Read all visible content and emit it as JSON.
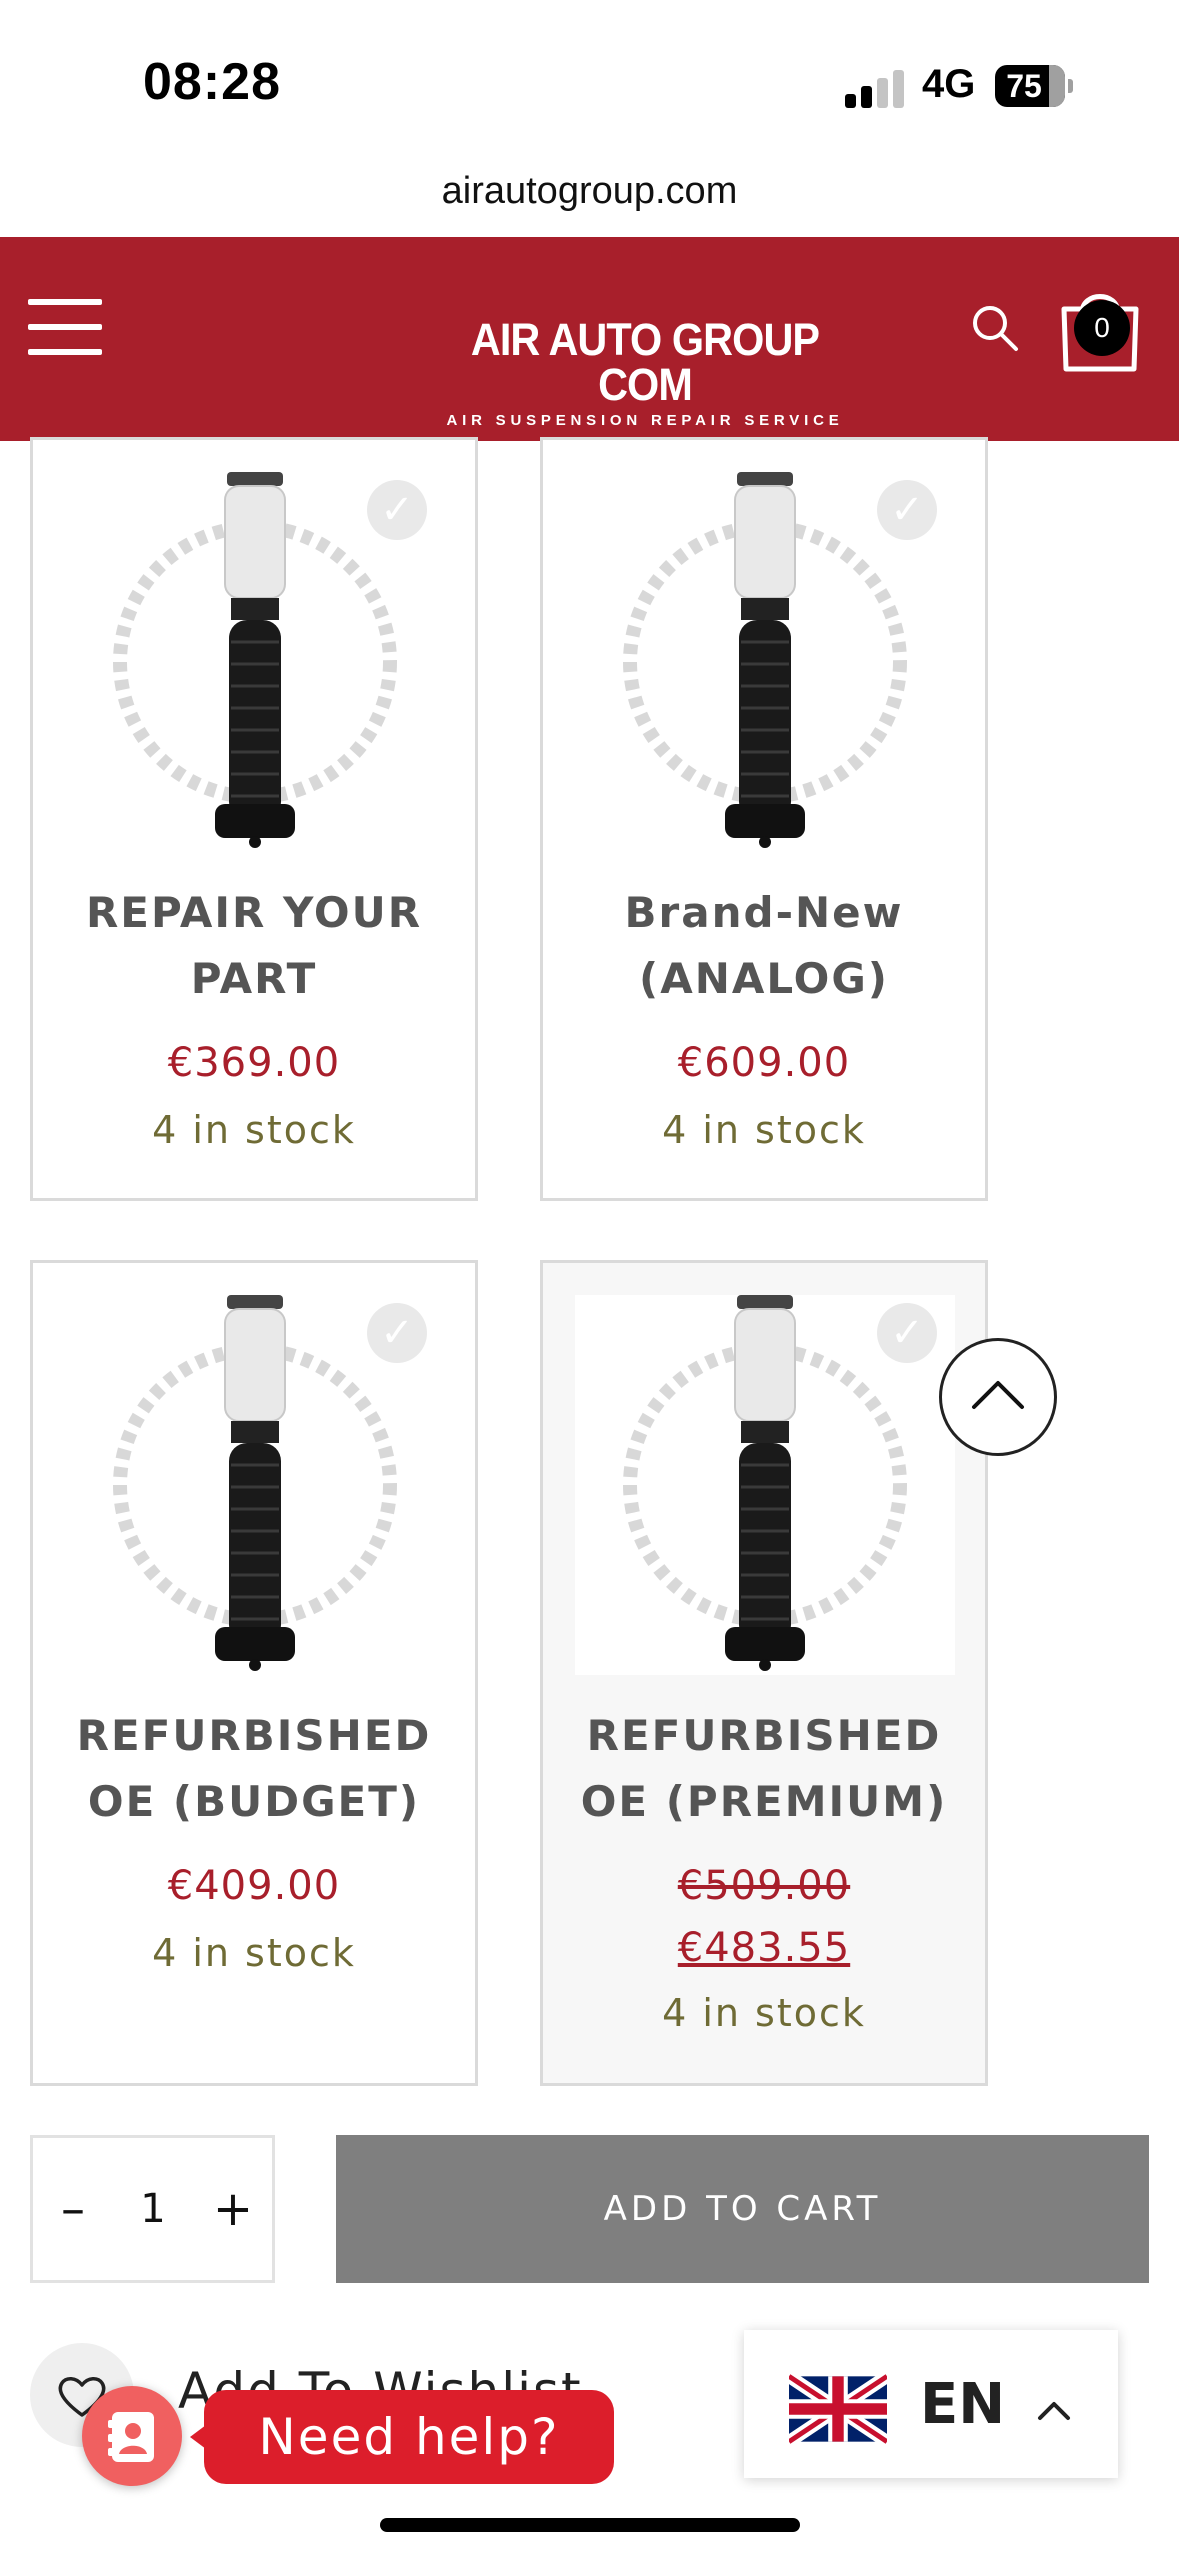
{
  "status_bar": {
    "time": "08:28",
    "network": "4G",
    "battery": "75"
  },
  "browser": {
    "url": "airautogroup.com"
  },
  "header": {
    "logo_title": "AIR AUTO GROUP COM",
    "logo_subtitle": "AIR SUSPENSION REPAIR SERVICE",
    "cart_count": "0",
    "icons": [
      "hamburger-menu-icon",
      "search-icon",
      "shopping-bag-icon"
    ]
  },
  "products": [
    {
      "title_line1": "REPAIR YOUR",
      "title_line2": "PART",
      "price": "€369.00",
      "stock": "4 in stock",
      "selected": false
    },
    {
      "title_line1": "Brand-New",
      "title_line2": "(ANALOG)",
      "price": "€609.00",
      "stock": "4 in stock",
      "selected": false
    },
    {
      "title_line1": "REFURBISHED",
      "title_line2": "OE (BUDGET)",
      "price": "€409.00",
      "stock": "4 in stock",
      "selected": false
    },
    {
      "title_line1": "REFURBISHED",
      "title_line2": "OE (PREMIUM)",
      "old_price": "€509.00",
      "price": "€483.55",
      "stock": "4 in stock",
      "selected": true
    }
  ],
  "purchase": {
    "minus": "–",
    "quantity": "1",
    "plus": "+",
    "add_to_cart": "ADD TO CART"
  },
  "wishlist": {
    "label": "Add To Wishlist"
  },
  "help": {
    "label": "Need help?"
  },
  "language": {
    "code": "EN"
  },
  "colors": {
    "brand_red": "#a81f2b",
    "price_red": "#a81f2b",
    "stock_olive": "#6f6b35",
    "button_gray": "#7f7f7f",
    "help_red": "#dc1e2b"
  }
}
